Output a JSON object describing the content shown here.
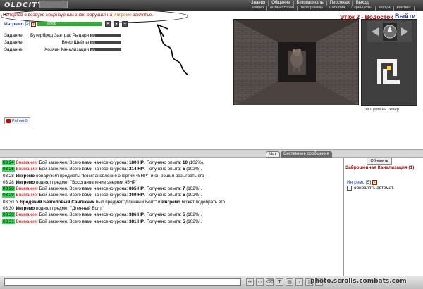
{
  "app": {
    "logo": "OLDCITY"
  },
  "nav": {
    "row1": [
      "Знания",
      "Общение",
      "Безопасность",
      "Персонаж",
      "Выход"
    ],
    "row2": [
      "Радио",
      "анти-история",
      "Телеграммы",
      "События",
      "Скриншоты",
      "Форум",
      "Рейтинг"
    ]
  },
  "system_message": {
    "before": "Начертав в воздухе нецензурный знак, обрушил на ",
    "name": "Ингремо",
    "after": " заклятье."
  },
  "player": {
    "name": "Ингремо",
    "level": "[5]",
    "info": "i",
    "hp_text": "66/66",
    "hp_fraction": 1.0
  },
  "tasks": [
    {
      "label": "Задание:",
      "name": "Бутерброд Завтрак Рыцаря",
      "progress": "0/1",
      "fraction": 0.0
    },
    {
      "label": "Задание:",
      "name": "Веер Шейпы",
      "progress": "0/1",
      "fraction": 0.0
    },
    {
      "label": "Задание:",
      "name": "Хозяин Канализации",
      "progress": "0/1",
      "fraction": 0.0
    }
  ],
  "location": {
    "title": "Этаж 2 - Водосток",
    "exit_label": "Выйти",
    "facing": "смотрим на север"
  },
  "chat_user": {
    "label": "Palmer@"
  },
  "tabs": {
    "chat": "Чат",
    "system": "Системные сообщения"
  },
  "chat_lines": [
    {
      "time": "03:24",
      "hl": true,
      "warn": "Внимание!",
      "text1": " Бой закончен. Всего вами нанесено урона: ",
      "dmg": "180 HP",
      "text2": ". Получено опыта: ",
      "exp": "10",
      "text3": " (102%)."
    },
    {
      "time": "03:26",
      "hl": true,
      "warn": "Внимание!",
      "text1": " Бой закончен. Всего вами нанесено урона: ",
      "dmg": "214 HP",
      "text2": ". Получено опыта: ",
      "exp": "5",
      "text3": " (102%)."
    },
    {
      "time": "03:28",
      "hl": false,
      "name": "Ингремо",
      "text": " обнаружил предметы \"Восстановление энергии 45HP\", и он решил разыграть его"
    },
    {
      "time": "03:28",
      "hl": false,
      "name": "Ингремо",
      "text": " поднял предмет \"Восстановление энергии 45HP\""
    },
    {
      "time": "03:28",
      "hl": true,
      "warn": "Внимание!",
      "text1": " Бой закончен. Всего вами нанесено урона: ",
      "dmg": "865 HP",
      "text2": ". Получено опыта: ",
      "exp": "7",
      "text3": " (102%)."
    },
    {
      "time": "03:29",
      "hl": true,
      "warn": "Внимание!",
      "text1": " Бой закончен. Всего вами нанесено урона: ",
      "dmg": "369 HP",
      "text2": ". Получено опыта: ",
      "exp": "5",
      "text3": " (102%)."
    },
    {
      "time": "03:30",
      "hl": false,
      "prefix": "У ",
      "name2": "Бродячий Безголовый Сантехник",
      "text": " был предмет \"Длинный Болт\" и ",
      "name": "Ингремо",
      "text_end": " может подобрать его"
    },
    {
      "time": "03:30",
      "hl": false,
      "name": "Ингремо",
      "text": " поднял предмет \"Длинный Болт\""
    },
    {
      "time": "03:30",
      "hl": true,
      "warn": "Внимание!",
      "text1": " Бой закончен. Всего вами нанесено урона: ",
      "dmg": "386 HP",
      "text2": ". Получено опыта: ",
      "exp": "5",
      "text3": " (102%)."
    },
    {
      "time": "03:31",
      "hl": true,
      "warn": "Внимание!",
      "text1": " Бой закончен. Всего вами нанесено урона: ",
      "dmg": "381 HP",
      "text2": ". Получено опыта: ",
      "exp": "5",
      "text3": " (102%)."
    }
  ],
  "right_panel": {
    "refresh_label": "Обновить",
    "room_title": "Заброшенная Канализация (1)",
    "user": {
      "name": "Ингремо",
      "level": "[5]"
    },
    "auto_refresh_label": "обновлять автомат."
  },
  "watermark": "photo.scrolls.combats.com",
  "colors": {
    "warn": "#d00000",
    "accent": "#b00000",
    "link": "#1a3ea0",
    "time_highlight": "#33dd55"
  }
}
